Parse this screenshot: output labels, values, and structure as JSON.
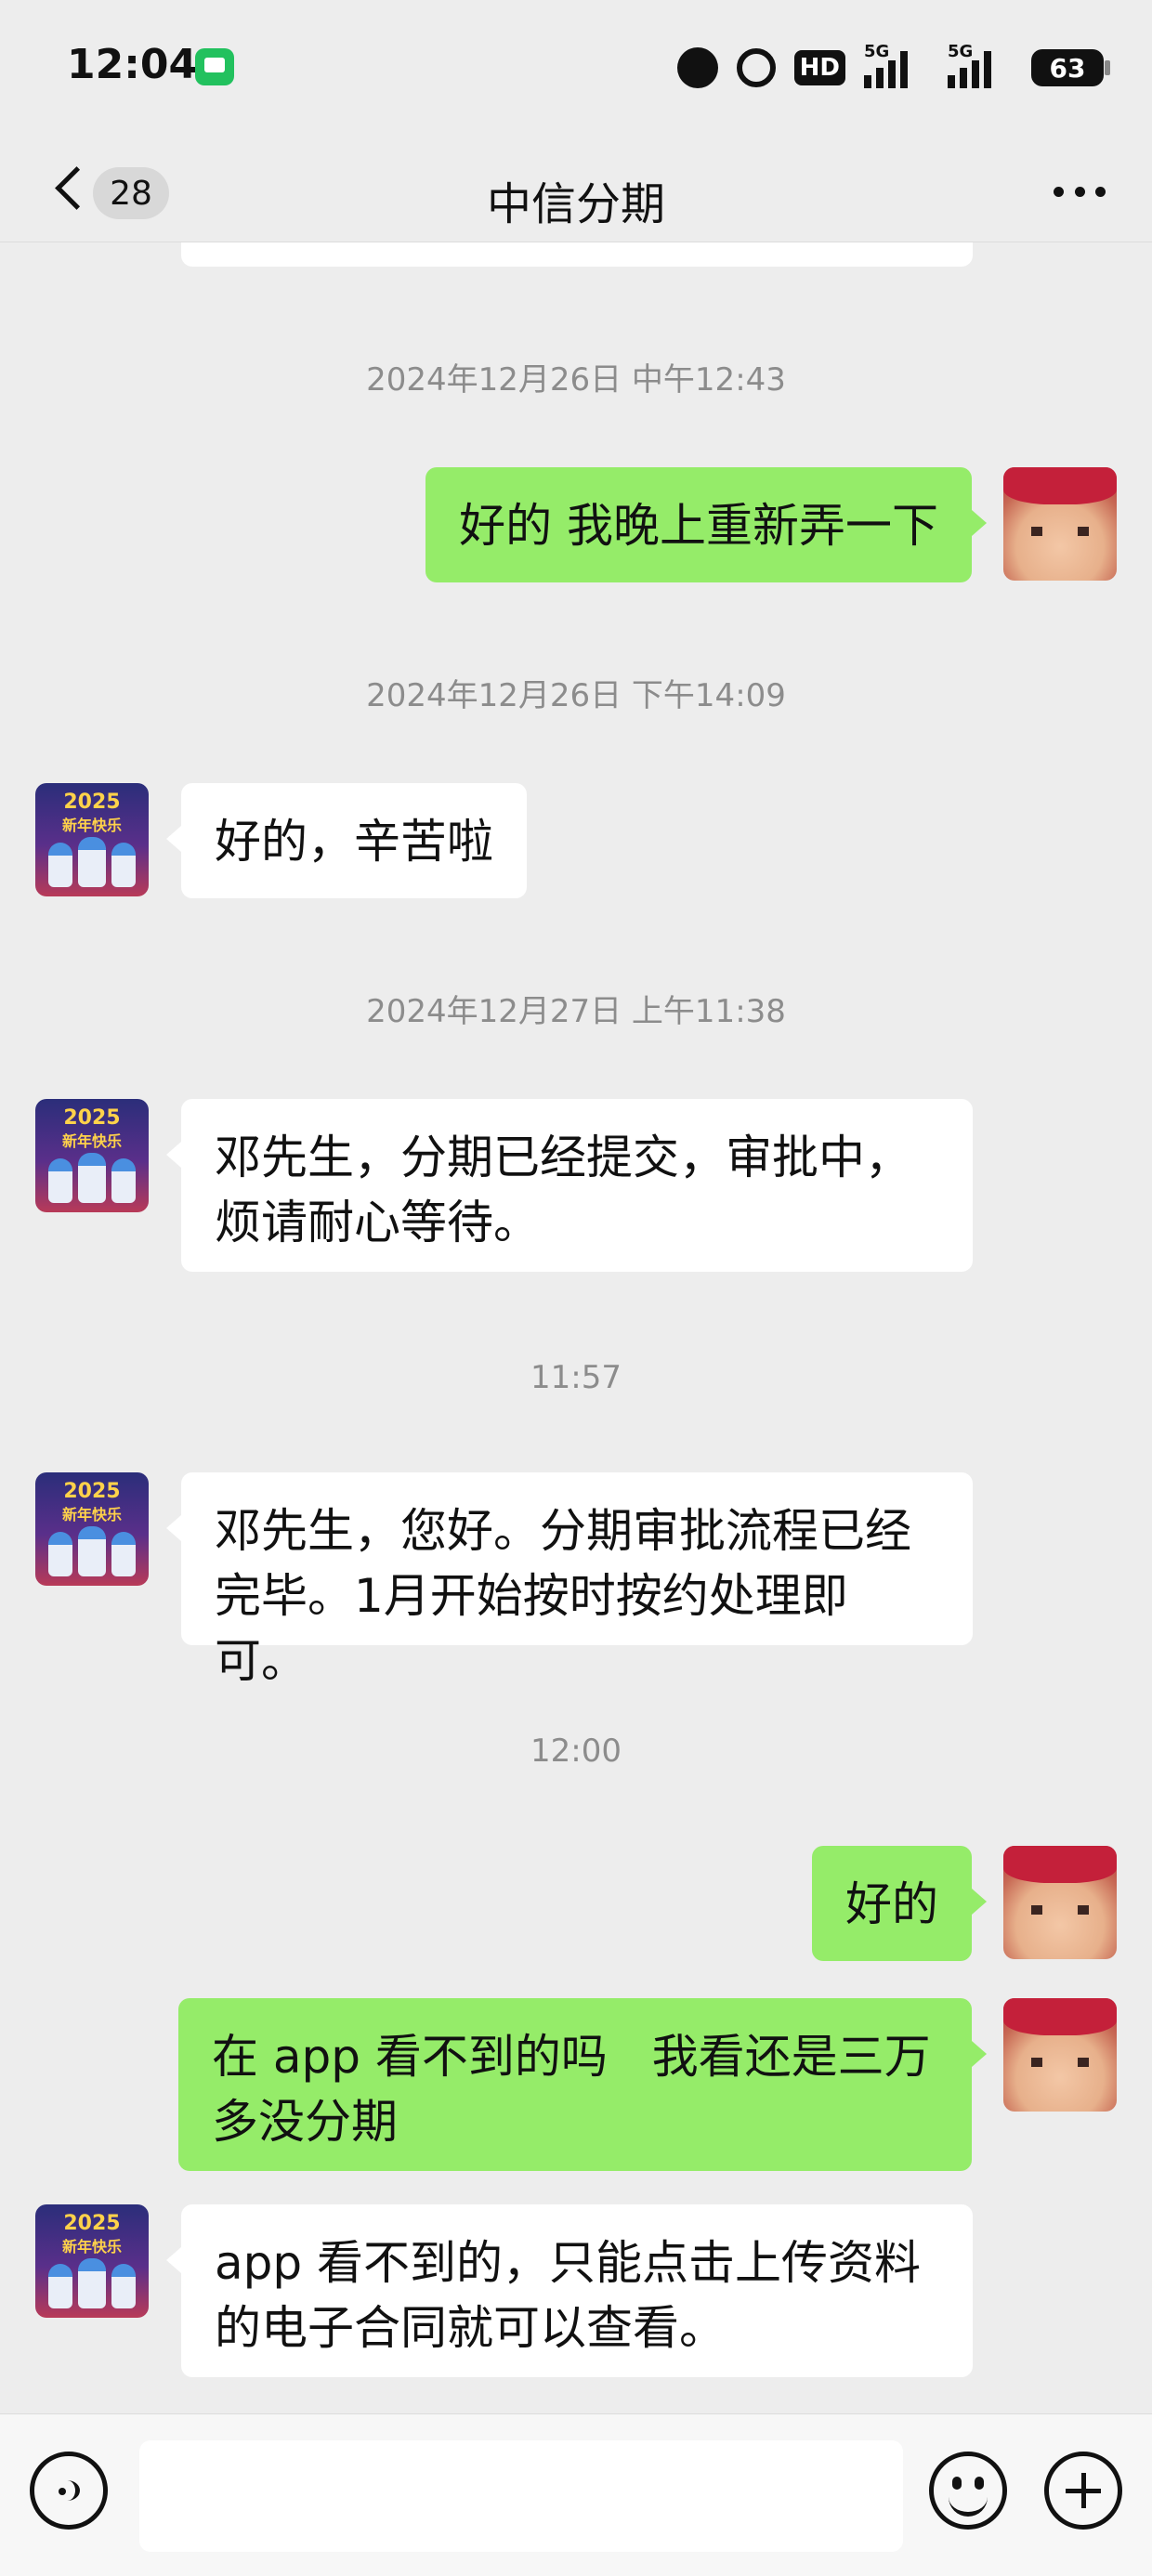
{
  "status_bar": {
    "time": "12:04",
    "hd_label": "HD",
    "signal_1_label": "5G",
    "signal_2_label": "5G",
    "battery_level": "63",
    "icons": [
      "messages-notification-icon",
      "speedometer-icon",
      "alarm-icon",
      "hd-icon",
      "signal-icon",
      "signal-icon",
      "battery-icon"
    ]
  },
  "nav": {
    "back_icon": "chevron-left-icon",
    "unread_count": "28",
    "title": "中信分期",
    "more_icon": "more-horizontal-icon"
  },
  "chat": {
    "timestamps": [
      "2024年12月26日 中午12:43",
      "2024年12月26日 下午14:09",
      "2024年12月27日 上午11:38",
      "11:57",
      "12:00"
    ],
    "messages": [
      {
        "from": "me",
        "text": "好的 我晚上重新弄一下"
      },
      {
        "from": "other",
        "text": "好的，辛苦啦"
      },
      {
        "from": "other",
        "text": "邓先生，分期已经提交，审批中，\n烦请耐心等待。"
      },
      {
        "from": "other",
        "text": "邓先生，您好。分期审批流程已经\n完毕。1月开始按时按约处理即可。"
      },
      {
        "from": "me",
        "text": "好的"
      },
      {
        "from": "me",
        "text": "在 app 看不到的吗   我看还是三万\n多没分期"
      },
      {
        "from": "other",
        "text": "app 看不到的，只能点击上传资料\n的电子合同就可以查看。"
      }
    ],
    "contact_avatar_text": {
      "year": "2025",
      "greeting": "新年快乐"
    }
  },
  "input_bar": {
    "voice_icon": "voice-icon",
    "message_value": "",
    "emoji_icon": "emoji-icon",
    "plus_icon": "plus-icon"
  },
  "colors": {
    "background": "#ededed",
    "outgoing_bubble": "#95ec69",
    "incoming_bubble": "#ffffff",
    "timestamp_text": "#8c8c8c"
  }
}
